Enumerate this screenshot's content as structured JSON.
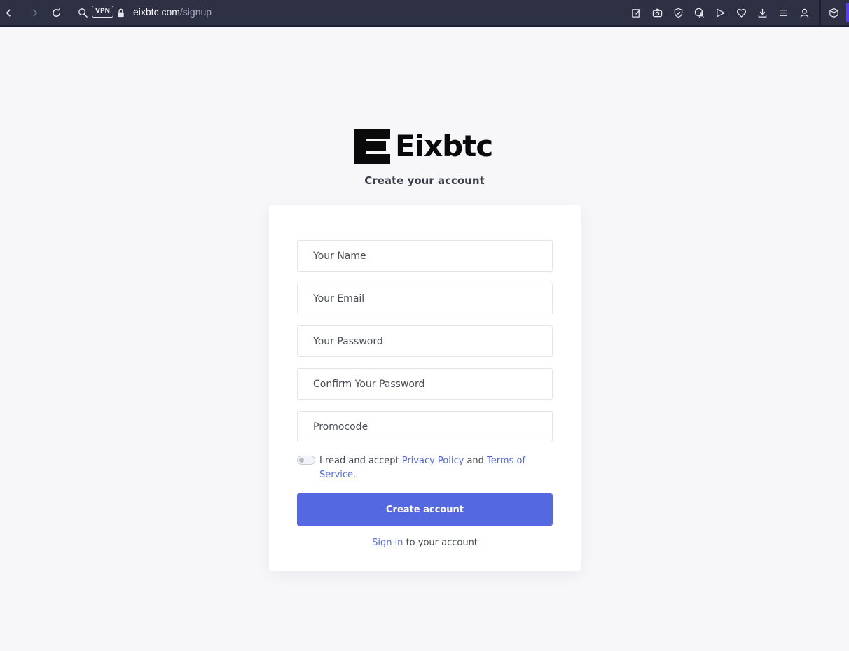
{
  "browser": {
    "vpn_label": "VPN",
    "url_host": "eixbtc.com",
    "url_path": "/signup"
  },
  "brand": {
    "name": "Eixbtc"
  },
  "page": {
    "subtitle": "Create your account"
  },
  "form": {
    "name_placeholder": "Your Name",
    "email_placeholder": "Your Email",
    "password_placeholder": "Your Password",
    "confirm_placeholder": "Confirm Your Password",
    "promo_placeholder": "Promocode",
    "accept_prefix": "I read and accept",
    "privacy_link": "Privacy Policy",
    "and_text": "and",
    "terms_link": "Terms of Service",
    "period": ".",
    "accept_checked": false,
    "submit_label": "Create account",
    "signin_link": "Sign in",
    "signin_suffix": "to your account"
  },
  "colors": {
    "accent": "#5468e2",
    "link": "#5468e7",
    "page_bg": "#f7f7f9",
    "toolbar_bg": "#2e3044"
  }
}
